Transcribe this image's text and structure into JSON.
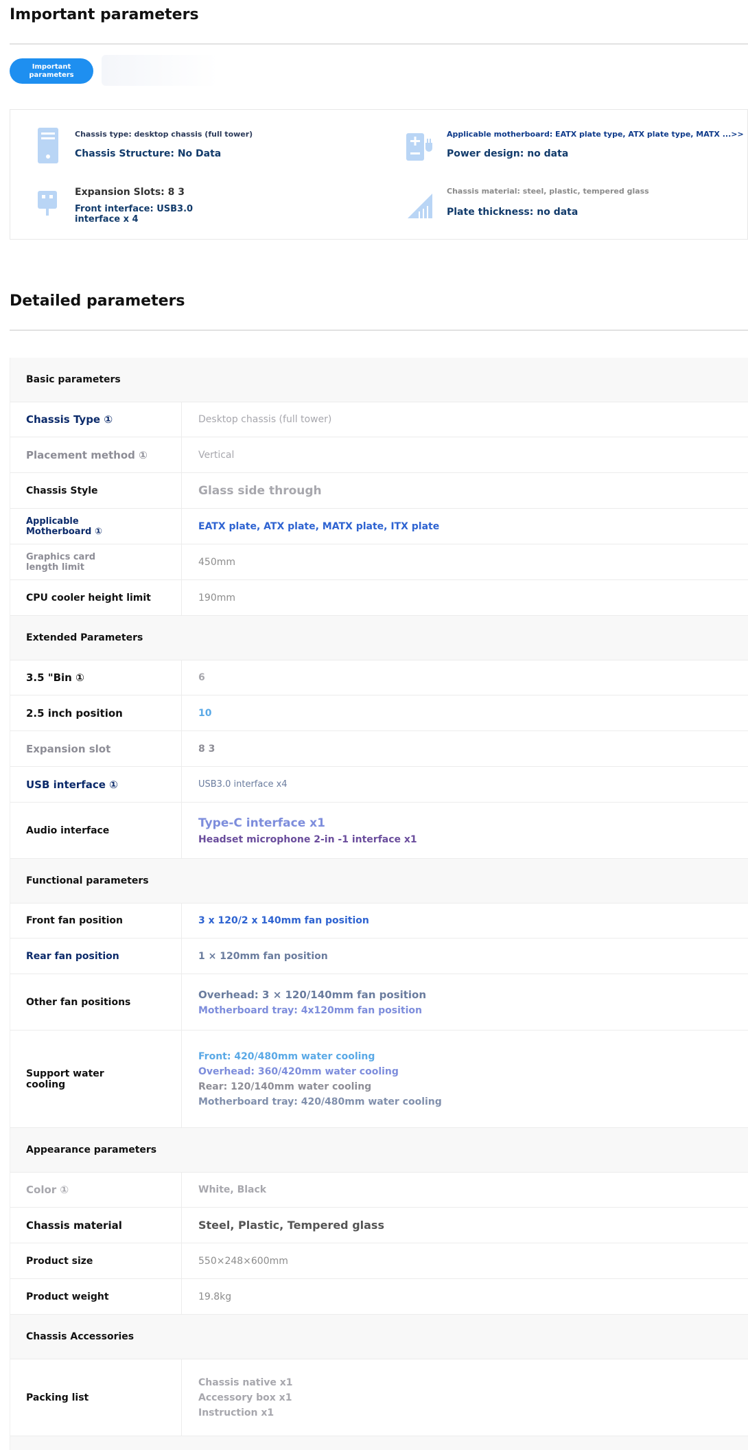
{
  "important": {
    "title": "Important parameters",
    "pill_label": "Important parameters",
    "items": [
      {
        "small": "Chassis type: desktop chassis (full tower)",
        "main": "Chassis Structure: No Data",
        "icon": "chassis-icon"
      },
      {
        "small": "Applicable motherboard: EATX plate type, ATX plate type, MATX ...>>",
        "main": "Power design: no data",
        "icon": "power-plug-icon"
      },
      {
        "small": "Expansion Slots: 8 3",
        "main": "Front interface: USB3.0 interface x 4",
        "icon": "usb-icon"
      },
      {
        "small": "Chassis material: steel, plastic, tempered glass",
        "main": "Plate thickness: no data",
        "icon": "ruler-icon"
      }
    ]
  },
  "detailed": {
    "title": "Detailed parameters",
    "groups": [
      {
        "name": "Basic parameters",
        "rows": [
          {
            "label": "Chassis Type ①",
            "values": [
              "Desktop chassis (full tower)"
            ]
          },
          {
            "label": "Placement method ①",
            "values": [
              "Vertical"
            ]
          },
          {
            "label": "Chassis Style",
            "values": [
              "Glass side through"
            ]
          },
          {
            "label": "Applicable Motherboard ①",
            "values": [
              "EATX plate, ATX plate, MATX plate, ITX plate"
            ]
          },
          {
            "label": "Graphics card length limit",
            "values": [
              "450mm"
            ]
          },
          {
            "label": "CPU cooler height limit",
            "values": [
              "190mm"
            ]
          }
        ]
      },
      {
        "name": "Extended Parameters",
        "rows": [
          {
            "label": "3.5 \"Bin ①",
            "values": [
              "6"
            ]
          },
          {
            "label": "2.5 inch position",
            "values": [
              "10"
            ]
          },
          {
            "label": "Expansion slot",
            "values": [
              "8 3"
            ]
          },
          {
            "label": "USB interface ①",
            "values": [
              "USB3.0 interface x4"
            ]
          },
          {
            "label": "Audio interface",
            "values": [
              "Type-C interface x1",
              "Headset microphone 2-in -1 interface x1"
            ]
          }
        ]
      },
      {
        "name": "Functional parameters",
        "rows": [
          {
            "label": "Front fan position",
            "values": [
              "3 x 120/2 x 140mm fan position"
            ]
          },
          {
            "label": "Rear fan position",
            "values": [
              "1 × 120mm fan position"
            ]
          },
          {
            "label": "Other fan positions",
            "values": [
              "Overhead: 3 × 120/140mm fan position",
              "Motherboard tray: 4x120mm fan position"
            ]
          },
          {
            "label": "Support water cooling",
            "values": [
              "Front: 420/480mm water cooling",
              "Overhead: 360/420mm water cooling",
              "Rear: 120/140mm water cooling",
              "Motherboard tray: 420/480mm water cooling"
            ]
          }
        ]
      },
      {
        "name": "Appearance parameters",
        "rows": [
          {
            "label": "Color ①",
            "values": [
              "White, Black"
            ]
          },
          {
            "label": "Chassis material",
            "values": [
              "Steel, Plastic, Tempered glass"
            ]
          },
          {
            "label": "Product size",
            "values": [
              "550×248×600mm"
            ]
          },
          {
            "label": "Product weight",
            "values": [
              "19.8kg"
            ]
          }
        ]
      },
      {
        "name": "Chassis Accessories",
        "rows": [
          {
            "label": "Packing list",
            "values": [
              "Chassis native x1",
              "Accessory box x1",
              "Instruction x1"
            ]
          }
        ]
      }
    ]
  }
}
